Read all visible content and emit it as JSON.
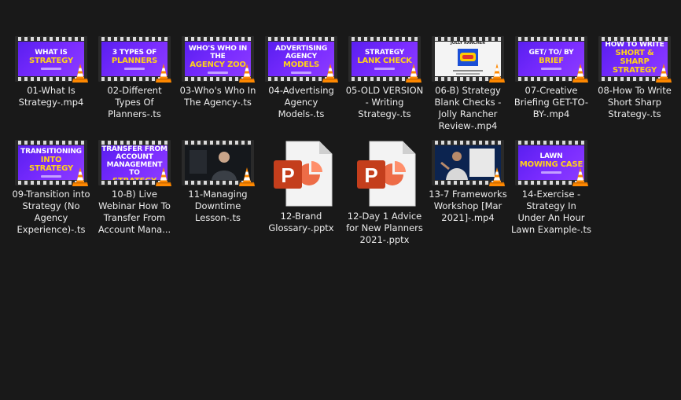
{
  "files": [
    {
      "label": "01-What Is Strategy-.mp4",
      "type": "video",
      "line1": "WHAT IS",
      "line2": "STRATEGY"
    },
    {
      "label": "02-Different Types Of Planners-.ts",
      "type": "video",
      "line1": "3 TYPES OF",
      "line2": "PLANNERS"
    },
    {
      "label": "03-Who's Who In The Agency-.ts",
      "type": "video",
      "line1": "WHO'S WHO IN THE",
      "line2": "AGENCY ZOO"
    },
    {
      "label": "04-Advertising Agency Models-.ts",
      "type": "video",
      "line1": "ADVERTISING AGENCY",
      "line2": "MODELS"
    },
    {
      "label": "05-OLD VERSION - Writing Strategy-.ts",
      "type": "video",
      "line1": "STRATEGY",
      "line2": "LANK CHECK"
    },
    {
      "label": "06-B) Strategy Blank Checks - Jolly Rancher Review-.mp4",
      "type": "video-white",
      "line1": "JOLLY RANCHER",
      "line2": ""
    },
    {
      "label": "07-Creative Briefing GET-TO-BY-.mp4",
      "type": "video",
      "line1": "GET/ TO/ BY",
      "line2": "BRIEF"
    },
    {
      "label": "08-How To Write Short Sharp Strategy-.ts",
      "type": "video",
      "line1": "HOW TO WRITE",
      "line2": "SHORT & SHARP STRATEGY"
    },
    {
      "label": "09-Transition into Strategy (No Agency Experience)-.ts",
      "type": "video",
      "line1": "TRANSITIONING",
      "line2": "INTO STRATEGY"
    },
    {
      "label": "10-B) Live Webinar How To Transfer From Account Mana...",
      "type": "video",
      "line1": "HOW TO TRANSFER FROM ACCOUNT MANAGEMENT TO",
      "line2": "STRATEGY"
    },
    {
      "label": "11-Managing Downtime Lesson-.ts",
      "type": "video-dark",
      "line1": "",
      "line2": ""
    },
    {
      "label": "12-Brand Glossary-.pptx",
      "type": "pptx"
    },
    {
      "label": "12-Day 1 Advice for New Planners 2021-.pptx",
      "type": "pptx"
    },
    {
      "label": "13-7 Frameworks Workshop [Mar 2021]-.mp4",
      "type": "video-photo",
      "line1": "",
      "line2": ""
    },
    {
      "label": "14-Exercise - Strategy In Under An Hour Lawn Example-.ts",
      "type": "video",
      "line1": "LAWN",
      "line2": "MOWING CASE"
    }
  ],
  "colors": {
    "background": "#191919",
    "text": "#ececec",
    "thumb_purple": "#7a2cff",
    "thumb_yellow": "#ffd21a",
    "pptx_red": "#c43e1c",
    "vlc_orange": "#ff8800"
  },
  "icons": {
    "video": "vlc-cone-icon",
    "pptx": "powerpoint-file-icon"
  }
}
